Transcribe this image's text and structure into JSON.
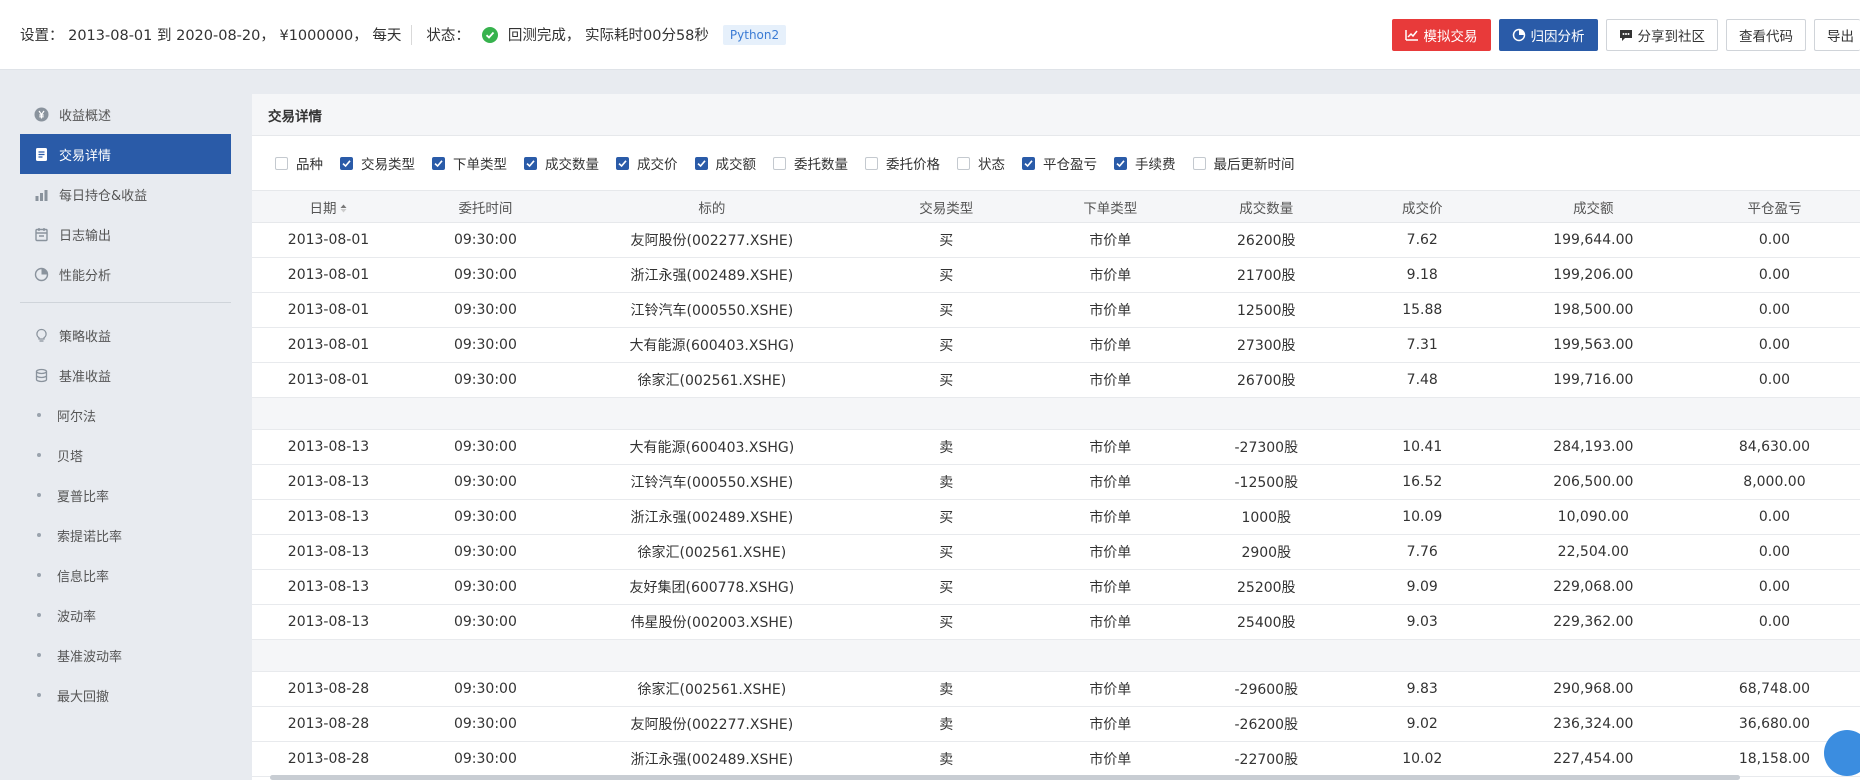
{
  "header": {
    "settings_text": "设置：  2013-08-01 到 2020-08-20，  ¥1000000，  每天",
    "status_label": "状态：",
    "status_text": "回测完成，  实际耗时00分58秒",
    "python_badge": "Python2",
    "buttons": {
      "simulate": "模拟交易",
      "attribution": "归因分析",
      "share": "分享到社区",
      "view_code": "查看代码",
      "export": "导出"
    }
  },
  "sidebar": {
    "primary": [
      {
        "label": "收益概述",
        "icon": "yuan-icon"
      },
      {
        "label": "交易详情",
        "icon": "document-icon"
      },
      {
        "label": "每日持仓&收益",
        "icon": "bar-chart-icon"
      },
      {
        "label": "日志输出",
        "icon": "calendar-icon"
      },
      {
        "label": "性能分析",
        "icon": "pie-icon"
      }
    ],
    "secondary": [
      {
        "label": "策略收益",
        "icon": "bulb-icon"
      },
      {
        "label": "基准收益",
        "icon": "database-icon"
      }
    ],
    "sub": [
      "阿尔法",
      "贝塔",
      "夏普比率",
      "索提诺比率",
      "信息比率",
      "波动率",
      "基准波动率",
      "最大回撤"
    ]
  },
  "panel": {
    "title": "交易详情",
    "filters": [
      {
        "label": "品种",
        "checked": false
      },
      {
        "label": "交易类型",
        "checked": true
      },
      {
        "label": "下单类型",
        "checked": true
      },
      {
        "label": "成交数量",
        "checked": true
      },
      {
        "label": "成交价",
        "checked": true
      },
      {
        "label": "成交额",
        "checked": true
      },
      {
        "label": "委托数量",
        "checked": false
      },
      {
        "label": "委托价格",
        "checked": false
      },
      {
        "label": "状态",
        "checked": false
      },
      {
        "label": "平仓盈亏",
        "checked": true
      },
      {
        "label": "手续费",
        "checked": true
      },
      {
        "label": "最后更新时间",
        "checked": false
      }
    ],
    "columns": [
      "日期",
      "委托时间",
      "标的",
      "交易类型",
      "下单类型",
      "成交数量",
      "成交价",
      "成交额",
      "平仓盈亏"
    ],
    "groups": [
      [
        [
          "2013-08-01",
          "09:30:00",
          "友阿股份(002277.XSHE)",
          "买",
          "市价单",
          "26200股",
          "7.62",
          "199,644.00",
          "0.00"
        ],
        [
          "2013-08-01",
          "09:30:00",
          "浙江永强(002489.XSHE)",
          "买",
          "市价单",
          "21700股",
          "9.18",
          "199,206.00",
          "0.00"
        ],
        [
          "2013-08-01",
          "09:30:00",
          "江铃汽车(000550.XSHE)",
          "买",
          "市价单",
          "12500股",
          "15.88",
          "198,500.00",
          "0.00"
        ],
        [
          "2013-08-01",
          "09:30:00",
          "大有能源(600403.XSHG)",
          "买",
          "市价单",
          "27300股",
          "7.31",
          "199,563.00",
          "0.00"
        ],
        [
          "2013-08-01",
          "09:30:00",
          "徐家汇(002561.XSHE)",
          "买",
          "市价单",
          "26700股",
          "7.48",
          "199,716.00",
          "0.00"
        ]
      ],
      [
        [
          "2013-08-13",
          "09:30:00",
          "大有能源(600403.XSHG)",
          "卖",
          "市价单",
          "-27300股",
          "10.41",
          "284,193.00",
          "84,630.00"
        ],
        [
          "2013-08-13",
          "09:30:00",
          "江铃汽车(000550.XSHE)",
          "卖",
          "市价单",
          "-12500股",
          "16.52",
          "206,500.00",
          "8,000.00"
        ],
        [
          "2013-08-13",
          "09:30:00",
          "浙江永强(002489.XSHE)",
          "买",
          "市价单",
          "1000股",
          "10.09",
          "10,090.00",
          "0.00"
        ],
        [
          "2013-08-13",
          "09:30:00",
          "徐家汇(002561.XSHE)",
          "买",
          "市价单",
          "2900股",
          "7.76",
          "22,504.00",
          "0.00"
        ],
        [
          "2013-08-13",
          "09:30:00",
          "友好集团(600778.XSHG)",
          "买",
          "市价单",
          "25200股",
          "9.09",
          "229,068.00",
          "0.00"
        ],
        [
          "2013-08-13",
          "09:30:00",
          "伟星股份(002003.XSHE)",
          "买",
          "市价单",
          "25400股",
          "9.03",
          "229,362.00",
          "0.00"
        ]
      ],
      [
        [
          "2013-08-28",
          "09:30:00",
          "徐家汇(002561.XSHE)",
          "卖",
          "市价单",
          "-29600股",
          "9.83",
          "290,968.00",
          "68,748.00"
        ],
        [
          "2013-08-28",
          "09:30:00",
          "友阿股份(002277.XSHE)",
          "卖",
          "市价单",
          "-26200股",
          "9.02",
          "236,324.00",
          "36,680.00"
        ],
        [
          "2013-08-28",
          "09:30:00",
          "浙江永强(002489.XSHE)",
          "卖",
          "市价单",
          "-22700股",
          "10.02",
          "227,454.00",
          "18,158.00"
        ]
      ]
    ]
  }
}
